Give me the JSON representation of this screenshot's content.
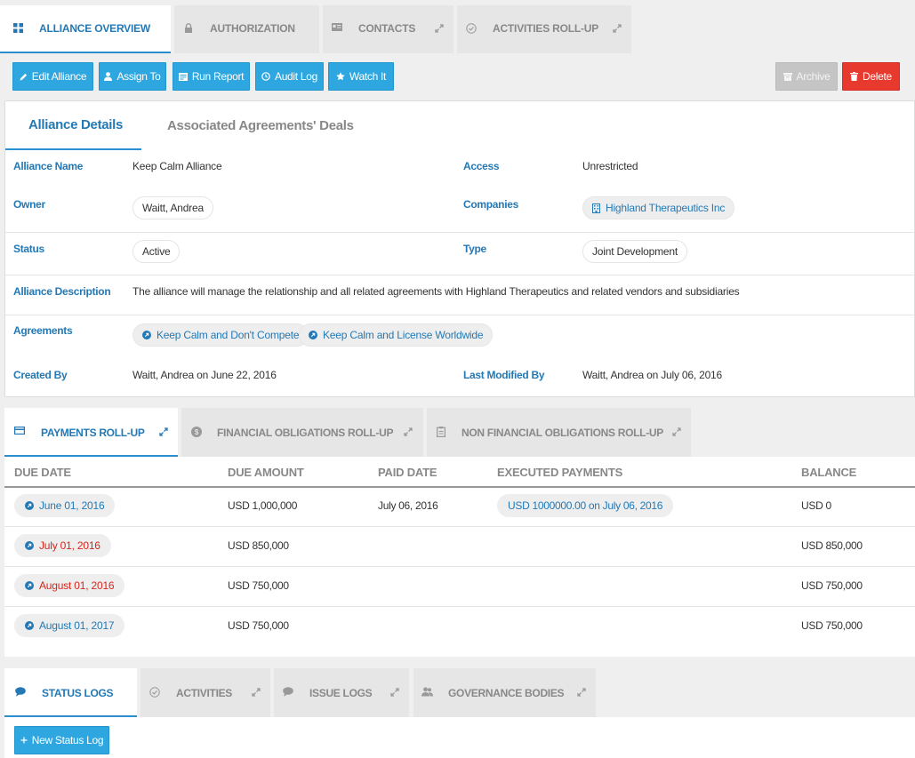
{
  "top_tabs": [
    {
      "label": "ALLIANCE OVERVIEW",
      "icon": "grid-icon",
      "active": true
    },
    {
      "label": "AUTHORIZATION",
      "icon": "lock-icon",
      "active": false
    },
    {
      "label": "CONTACTS",
      "icon": "contact-card-icon",
      "active": false
    },
    {
      "label": "ACTIVITIES ROLL-UP",
      "icon": "check-circle-icon",
      "active": false
    }
  ],
  "toolbar": {
    "edit": "Edit Alliance",
    "assign": "Assign To",
    "report": "Run Report",
    "audit": "Audit Log",
    "watch": "Watch It",
    "archive": "Archive",
    "delete": "Delete"
  },
  "detail_tabs": {
    "details": "Alliance Details",
    "deals": "Associated Agreements' Deals"
  },
  "details": {
    "alliance_name_label": "Alliance Name",
    "alliance_name": "Keep Calm Alliance",
    "access_label": "Access",
    "access": "Unrestricted",
    "owner_label": "Owner",
    "owner": "Waitt, Andrea",
    "companies_label": "Companies",
    "company": "Highland Therapeutics Inc",
    "status_label": "Status",
    "status": "Active",
    "type_label": "Type",
    "type": "Joint Development",
    "description_label": "Alliance Description",
    "description": "The alliance will manage the relationship and all related agreements with Highland Therapeutics and related vendors and subsidiaries",
    "agreements_label": "Agreements",
    "agreements": [
      "Keep Calm and Don't Compete",
      "Keep Calm and License Worldwide"
    ],
    "created_by_label": "Created By",
    "created_by": "Waitt, Andrea on June 22, 2016",
    "modified_by_label": "Last Modified By",
    "modified_by": "Waitt, Andrea on July 06, 2016"
  },
  "payment_tabs": [
    {
      "label": "PAYMENTS ROLL-UP",
      "active": true
    },
    {
      "label": "FINANCIAL OBLIGATIONS ROLL-UP",
      "active": false
    },
    {
      "label": "NON FINANCIAL OBLIGATIONS ROLL-UP",
      "active": false
    }
  ],
  "payments": {
    "columns": [
      "DUE DATE",
      "DUE AMOUNT",
      "PAID DATE",
      "EXECUTED PAYMENTS",
      "BALANCE"
    ],
    "rows": [
      {
        "due_date": "June 01, 2016",
        "overdue": false,
        "due_amount": "USD 1,000,000",
        "paid_date": "July 06, 2016",
        "executed": "USD 1000000.00 on July 06, 2016",
        "balance": "USD 0"
      },
      {
        "due_date": "July 01, 2016",
        "overdue": true,
        "due_amount": "USD 850,000",
        "paid_date": "",
        "executed": "",
        "balance": "USD 850,000"
      },
      {
        "due_date": "August 01, 2016",
        "overdue": true,
        "due_amount": "USD 750,000",
        "paid_date": "",
        "executed": "",
        "balance": "USD 750,000"
      },
      {
        "due_date": "August 01, 2017",
        "overdue": false,
        "due_amount": "USD 750,000",
        "paid_date": "",
        "executed": "",
        "balance": "USD 750,000"
      }
    ]
  },
  "bottom_tabs": [
    {
      "label": "STATUS LOGS",
      "active": true
    },
    {
      "label": "ACTIVITIES",
      "active": false
    },
    {
      "label": "ISSUE LOGS",
      "active": false
    },
    {
      "label": "GOVERNANCE BODIES",
      "active": false
    }
  ],
  "new_status_log": "New Status Log",
  "colors": {
    "accent": "#2479b5",
    "button_blue": "#2ea7e0",
    "danger": "#e8392f",
    "overdue": "#d9251c"
  }
}
